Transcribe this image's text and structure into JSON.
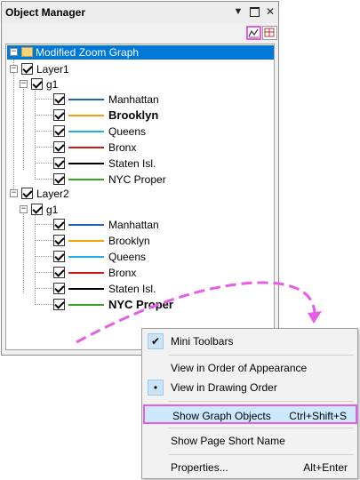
{
  "panel": {
    "title": "Object Manager",
    "pin_glyph": "▼",
    "close_glyph": "✕"
  },
  "tree": {
    "root_label": "Modified Zoom Graph",
    "collapse_glyph": "−",
    "layers": [
      {
        "label": "Layer1",
        "group": "g1",
        "items": [
          {
            "label": "Manhattan",
            "color": "#1f5fbf",
            "bold": false
          },
          {
            "label": "Brooklyn",
            "color": "#f5a000",
            "bold": true
          },
          {
            "label": "Queens",
            "color": "#20b0e8",
            "bold": false
          },
          {
            "label": "Bronx",
            "color": "#d01818",
            "bold": false
          },
          {
            "label": "Staten Isl.",
            "color": "#000000",
            "bold": false
          },
          {
            "label": "NYC Proper",
            "color": "#3aa020",
            "bold": false
          }
        ]
      },
      {
        "label": "Layer2",
        "group": "g1",
        "items": [
          {
            "label": "Manhattan",
            "color": "#1f5fbf",
            "bold": false
          },
          {
            "label": "Brooklyn",
            "color": "#f5a000",
            "bold": false
          },
          {
            "label": "Queens",
            "color": "#20b0e8",
            "bold": false
          },
          {
            "label": "Bronx",
            "color": "#d01818",
            "bold": false
          },
          {
            "label": "Staten Isl.",
            "color": "#000000",
            "bold": false
          },
          {
            "label": "NYC Proper",
            "color": "#3aa020",
            "bold": true
          }
        ]
      }
    ]
  },
  "menu": {
    "items": [
      {
        "label": "Mini Toolbars",
        "mark": "✔",
        "shortcut": ""
      },
      {
        "label": "View in Order of Appearance",
        "mark": "",
        "shortcut": ""
      },
      {
        "label": "View in Drawing Order",
        "mark": "•",
        "shortcut": ""
      },
      {
        "label": "Show Graph Objects",
        "mark": "",
        "shortcut": "Ctrl+Shift+S"
      },
      {
        "label": "Show Page Short Name",
        "mark": "",
        "shortcut": ""
      },
      {
        "label": "Properties...",
        "mark": "",
        "shortcut": "Alt+Enter"
      }
    ]
  },
  "colors": {
    "selection": "#0078d7",
    "annotation": "#e65ce6",
    "menu_highlight": "#cce8ff"
  },
  "icons": {
    "toolbar": [
      "graph-objects-icon",
      "layer-properties-icon"
    ],
    "tree": [
      "folder-icon",
      "checkbox-icon",
      "expander-icon"
    ]
  }
}
